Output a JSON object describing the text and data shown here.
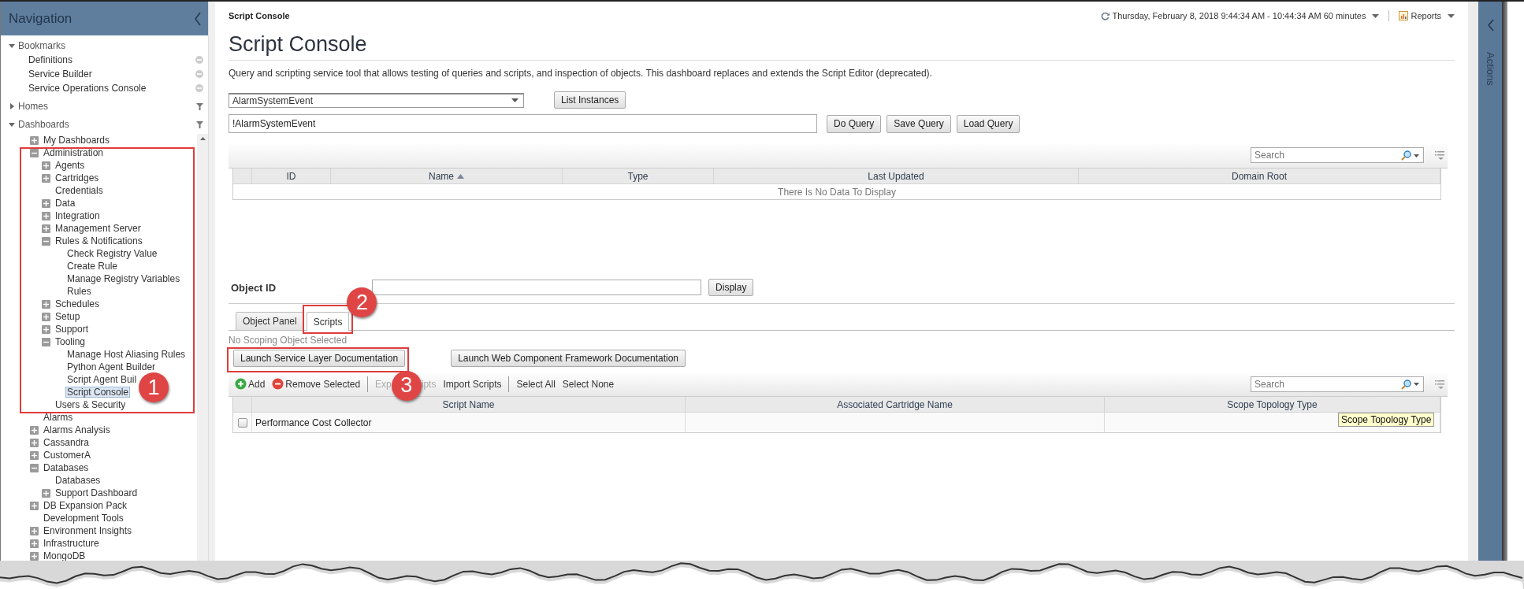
{
  "navigation": {
    "title": "Navigation",
    "sections": [
      {
        "label": "Bookmarks",
        "kind": "bookmarks",
        "expanded": true,
        "items": [
          {
            "label": "Definitions",
            "selected": false
          },
          {
            "label": "Service Builder",
            "selected": false
          },
          {
            "label": "Service Operations Console",
            "selected": false
          }
        ]
      },
      {
        "label": "Homes",
        "kind": "filterable",
        "expanded": false
      },
      {
        "label": "Dashboards",
        "kind": "filterable",
        "expanded": true,
        "tree": [
          {
            "label": "My Dashboards",
            "expanded": false,
            "selected": false
          },
          {
            "label": "Administration",
            "expanded": true,
            "selected": false,
            "children": [
              {
                "label": "Agents",
                "expanded": false,
                "selected": false
              },
              {
                "label": "Cartridges",
                "expanded": false,
                "selected": false
              },
              {
                "label": "Credentials",
                "selected": false
              },
              {
                "label": "Data",
                "expanded": false,
                "selected": false
              },
              {
                "label": "Integration",
                "expanded": false,
                "selected": false
              },
              {
                "label": "Management Server",
                "expanded": false,
                "selected": false
              },
              {
                "label": "Rules & Notifications",
                "expanded": true,
                "selected": false,
                "children": [
                  {
                    "label": "Check Registry Value",
                    "selected": false
                  },
                  {
                    "label": "Create Rule",
                    "selected": false
                  },
                  {
                    "label": "Manage Registry Variables",
                    "selected": false
                  },
                  {
                    "label": "Rules",
                    "selected": false
                  }
                ]
              },
              {
                "label": "Schedules",
                "expanded": false,
                "selected": false
              },
              {
                "label": "Setup",
                "expanded": false,
                "selected": false
              },
              {
                "label": "Support",
                "expanded": false,
                "selected": false
              },
              {
                "label": "Tooling",
                "expanded": true,
                "selected": false,
                "children": [
                  {
                    "label": "Manage Host Aliasing Rules",
                    "selected": false
                  },
                  {
                    "label": "Python Agent Builder",
                    "selected": false
                  },
                  {
                    "label": "Script Agent Buil",
                    "selected": false
                  },
                  {
                    "label": "Script Console",
                    "selected": true
                  }
                ]
              },
              {
                "label": "Users & Security",
                "selected": false
              }
            ]
          },
          {
            "label": "Alarms",
            "selected": false
          },
          {
            "label": "Alarms Analysis",
            "expanded": false,
            "selected": false
          },
          {
            "label": "Cassandra",
            "expanded": false,
            "selected": false
          },
          {
            "label": "CustomerA",
            "expanded": false,
            "selected": false
          },
          {
            "label": "Databases",
            "expanded": true,
            "selected": false,
            "children": [
              {
                "label": "Databases",
                "selected": false
              },
              {
                "label": "Support Dashboard",
                "expanded": false,
                "selected": false
              }
            ]
          },
          {
            "label": "DB Expansion Pack",
            "expanded": false,
            "selected": false
          },
          {
            "label": "Development Tools",
            "selected": false
          },
          {
            "label": "Environment Insights",
            "expanded": false,
            "selected": false
          },
          {
            "label": "Infrastructure",
            "expanded": false,
            "selected": false
          },
          {
            "label": "MongoDB",
            "expanded": false,
            "selected": false
          }
        ]
      }
    ]
  },
  "header": {
    "breadcrumb": "Script Console",
    "time_range": "Thursday, February 8, 2018 9:44:34 AM - 10:44:34 AM 60 minutes",
    "reports": "Reports"
  },
  "page": {
    "title": "Script Console",
    "description": "Query and scripting service tool that allows testing of queries and scripts, and inspection of objects. This dashboard replaces and extends the Script Editor (deprecated)."
  },
  "query": {
    "type_select": "AlarmSystemEvent",
    "list_button": "List Instances",
    "query_value": "!AlarmSystemEvent",
    "buttons": [
      "Do Query",
      "Save Query",
      "Load Query"
    ]
  },
  "results_table": {
    "search_placeholder": "Search",
    "columns": [
      {
        "label": "ID",
        "sorted": false
      },
      {
        "label": "Name",
        "sorted": true
      },
      {
        "label": "Type",
        "sorted": false
      },
      {
        "label": "Last Updated",
        "sorted": false
      },
      {
        "label": "Domain Root",
        "sorted": false
      }
    ],
    "empty_message": "There Is No Data To Display"
  },
  "object_id": {
    "label": "Object ID",
    "button": "Display"
  },
  "tabs": [
    {
      "label": "Object Panel",
      "selected": false
    },
    {
      "label": "Scripts",
      "selected": true
    }
  ],
  "scripts": {
    "status": "No Scoping Object Selected",
    "doc_buttons": [
      "Launch Service Layer Documentation",
      "Launch Web Component Framework Documentation"
    ],
    "toolbar": [
      {
        "kind": "add",
        "label": "Add",
        "disabled": false
      },
      {
        "kind": "remove",
        "label": "Remove Selected",
        "disabled": false
      },
      {
        "kind": "separator"
      },
      {
        "kind": "partial",
        "label": "Exp",
        "disabled": true
      },
      {
        "kind": "partial",
        "label": "ipts",
        "disabled": true
      },
      {
        "kind": "text",
        "label": "Import Scripts",
        "disabled": false
      },
      {
        "kind": "separator"
      },
      {
        "kind": "text",
        "label": "Select All",
        "disabled": false
      },
      {
        "kind": "text",
        "label": "Select None",
        "disabled": false
      }
    ],
    "search_placeholder": "Search",
    "columns": [
      "Script Name",
      "Associated Cartridge Name",
      "Scope Topology Type"
    ],
    "rows": [
      {
        "checked": false,
        "script_name": "Performance Cost Collector"
      }
    ],
    "tooltip": "Scope Topology Type"
  },
  "actions_panel": {
    "title": "Actions"
  },
  "annotations": [
    {
      "number": "1"
    },
    {
      "number": "2"
    },
    {
      "number": "3"
    }
  ]
}
